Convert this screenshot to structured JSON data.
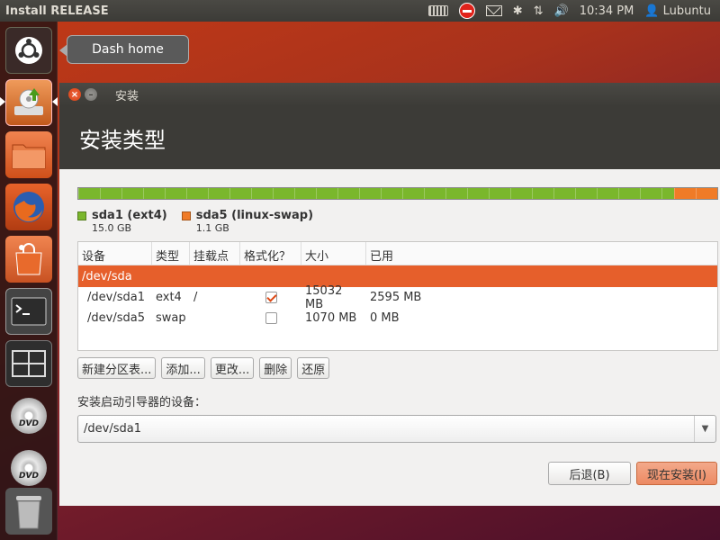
{
  "top_panel": {
    "title": "Install RELEASE",
    "time": "10:34 PM",
    "user": "Lubuntu",
    "icons": [
      "keyboard-icon",
      "stop-icon",
      "mail-icon",
      "bluetooth-icon",
      "network-icon",
      "volume-icon",
      "user-icon"
    ]
  },
  "launcher": {
    "tooltip": "Dash home",
    "dvd_label": "DVD",
    "items": [
      "dash-home-icon",
      "installer-icon",
      "files-icon",
      "firefox-icon",
      "software-center-icon",
      "terminal-icon",
      "workspace-switcher-icon",
      "dvd-icon",
      "dvd-icon",
      "trash-icon"
    ]
  },
  "window": {
    "title": "安装",
    "header": "安装类型",
    "partitions_legend": [
      {
        "name": "sda1 (ext4)",
        "size": "15.0 GB",
        "color": "#7ab72c"
      },
      {
        "name": "sda5 (linux-swap)",
        "size": "1.1 GB",
        "color": "#f07b27"
      }
    ],
    "table": {
      "headers": [
        "设备",
        "类型",
        "挂载点",
        "格式化？",
        "大小",
        "已用"
      ],
      "rows": [
        {
          "device": "/dev/sda",
          "type": "",
          "mount": "",
          "format": null,
          "size": "",
          "used": ""
        },
        {
          "device": "/dev/sda1",
          "type": "ext4",
          "mount": "/",
          "format": true,
          "size": "15032 MB",
          "used": "2595 MB"
        },
        {
          "device": "/dev/sda5",
          "type": "swap",
          "mount": "",
          "format": false,
          "size": "1070 MB",
          "used": "0 MB"
        }
      ]
    },
    "buttons": {
      "new_table": "新建分区表...",
      "add": "添加...",
      "change": "更改...",
      "delete": "删除",
      "revert": "还原"
    },
    "bootloader_label": "安装启动引导器的设备：",
    "bootloader_value": "/dev/sda1",
    "back": "后退(B)",
    "install_now": "现在安装(I)"
  },
  "colors": {
    "accent": "#dd4814",
    "ext4": "#7ab72c",
    "swap": "#f07b27"
  }
}
